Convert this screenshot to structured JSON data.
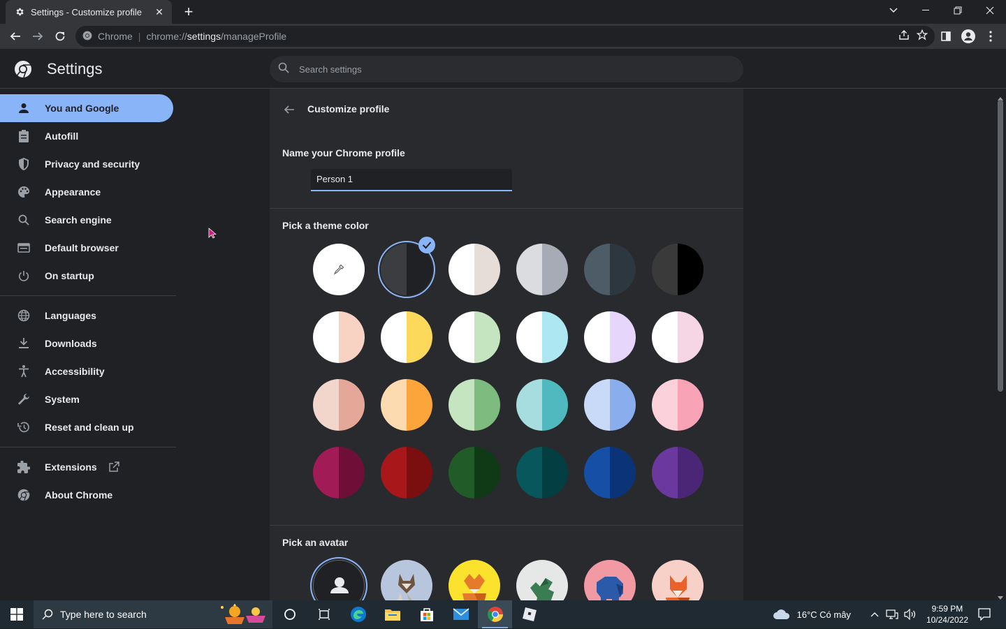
{
  "window": {
    "tab_title": "Settings - Customize profile",
    "new_tab": "+"
  },
  "omnibox": {
    "origin_label": "Chrome",
    "url_scheme": "chrome://",
    "url_host": "settings",
    "url_path": "/manageProfile"
  },
  "header": {
    "title": "Settings",
    "search_placeholder": "Search settings"
  },
  "sidebar": {
    "items": [
      {
        "label": "You and Google",
        "icon": "person-icon",
        "active": true
      },
      {
        "label": "Autofill",
        "icon": "clipboard-icon"
      },
      {
        "label": "Privacy and security",
        "icon": "shield-icon"
      },
      {
        "label": "Appearance",
        "icon": "palette-icon"
      },
      {
        "label": "Search engine",
        "icon": "search-icon"
      },
      {
        "label": "Default browser",
        "icon": "browser-icon"
      },
      {
        "label": "On startup",
        "icon": "power-icon"
      },
      {
        "label": "Languages",
        "icon": "globe-icon"
      },
      {
        "label": "Downloads",
        "icon": "download-icon"
      },
      {
        "label": "Accessibility",
        "icon": "accessibility-icon"
      },
      {
        "label": "System",
        "icon": "wrench-icon"
      },
      {
        "label": "Reset and clean up",
        "icon": "history-icon"
      },
      {
        "label": "Extensions",
        "icon": "puzzle-icon"
      },
      {
        "label": "About Chrome",
        "icon": "chrome-icon"
      }
    ]
  },
  "main": {
    "title": "Customize profile",
    "name_label": "Name your Chrome profile",
    "name_value": "Person 1",
    "theme_label": "Pick a theme color",
    "avatar_label": "Pick an avatar",
    "theme_colors": [
      [
        "#ffffff",
        "#ffffff"
      ],
      [
        "#3c3d40",
        "#202124"
      ],
      [
        "#ffffff",
        "#e6dcd8"
      ],
      [
        "#dadce0",
        "#a7abb5"
      ],
      [
        "#4d5c67",
        "#2c3740"
      ],
      [
        "#3a3a3a",
        "#000000"
      ],
      [
        "#ffffff",
        "#f8d2c2"
      ],
      [
        "#ffffff",
        "#fcd95a"
      ],
      [
        "#ffffff",
        "#c4e5c0"
      ],
      [
        "#ffffff",
        "#ade8f2"
      ],
      [
        "#ffffff",
        "#e6d6fb"
      ],
      [
        "#ffffff",
        "#f6d6e4"
      ],
      [
        "#f2d6cc",
        "#e5a898"
      ],
      [
        "#fddbb0",
        "#fba53a"
      ],
      [
        "#c4e5c0",
        "#7ebb7e"
      ],
      [
        "#a8dde0",
        "#4fb9bf"
      ],
      [
        "#c9daf8",
        "#8aaeed"
      ],
      [
        "#fbd2dc",
        "#f8a4b6"
      ],
      [
        "#a11b56",
        "#6f0f38"
      ],
      [
        "#a8181b",
        "#7b0f10"
      ],
      [
        "#215b28",
        "#103a16"
      ],
      [
        "#07575c",
        "#023e42"
      ],
      [
        "#1550a6",
        "#0b3478"
      ],
      [
        "#6b389f",
        "#4b2676"
      ]
    ],
    "avatars": [
      "default-avatar",
      "cat-avatar",
      "fox-avatar",
      "dragon-avatar",
      "elephant-avatar",
      "origami-fox-avatar"
    ]
  },
  "taskbar": {
    "search_placeholder": "Type here to search",
    "weather": "16°C  Có mây",
    "time": "9:59 PM",
    "date": "10/24/2022"
  }
}
